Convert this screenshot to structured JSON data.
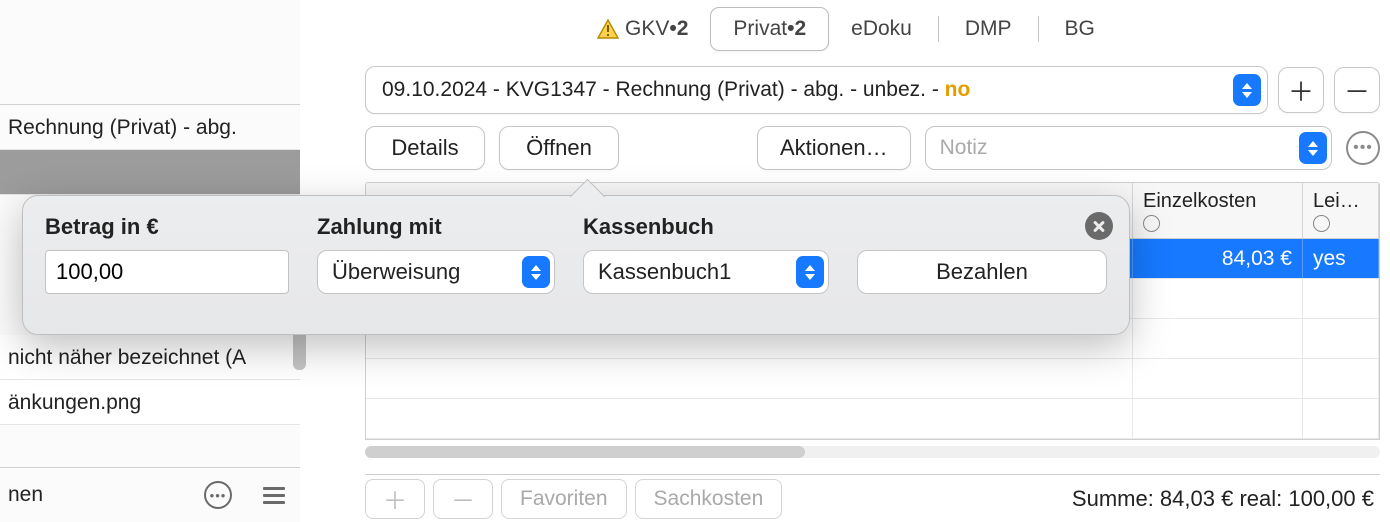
{
  "tabs": {
    "gkv": "GKV",
    "gkv_badge": "2",
    "privat": "Privat",
    "privat_badge": "2",
    "edoku": "eDoku",
    "dmp": "DMP",
    "bg": "BG"
  },
  "doc": {
    "prefix": "09.10.2024 - KVG1347 - Rechnung (Privat) - abg. - unbez. - ",
    "no": "no"
  },
  "toolbar": {
    "details": "Details",
    "open": "Öffnen",
    "actions": "Aktionen…",
    "note_placeholder": "Notiz"
  },
  "columns": {
    "einzelkosten": "Einzelkosten",
    "lei": "Lei…"
  },
  "row": {
    "einzelkosten": "84,03 €",
    "lei": "yes"
  },
  "footer": {
    "favoriten": "Favoriten",
    "sachkosten": "Sachkosten",
    "sum": "Summe: 84,03 € real: 100,00 €"
  },
  "left": {
    "item1": "Rechnung (Privat) - abg.",
    "item2": "nicht näher bezeichnet (A",
    "item3": "änkungen.png",
    "footer_label": "nen"
  },
  "popover": {
    "betrag_label": "Betrag in €",
    "betrag_value": "100,00",
    "zahlung_label": "Zahlung mit",
    "zahlung_value": "Überweisung",
    "kassenbuch_label": "Kassenbuch",
    "kassenbuch_value": "Kassenbuch1",
    "pay": "Bezahlen"
  }
}
